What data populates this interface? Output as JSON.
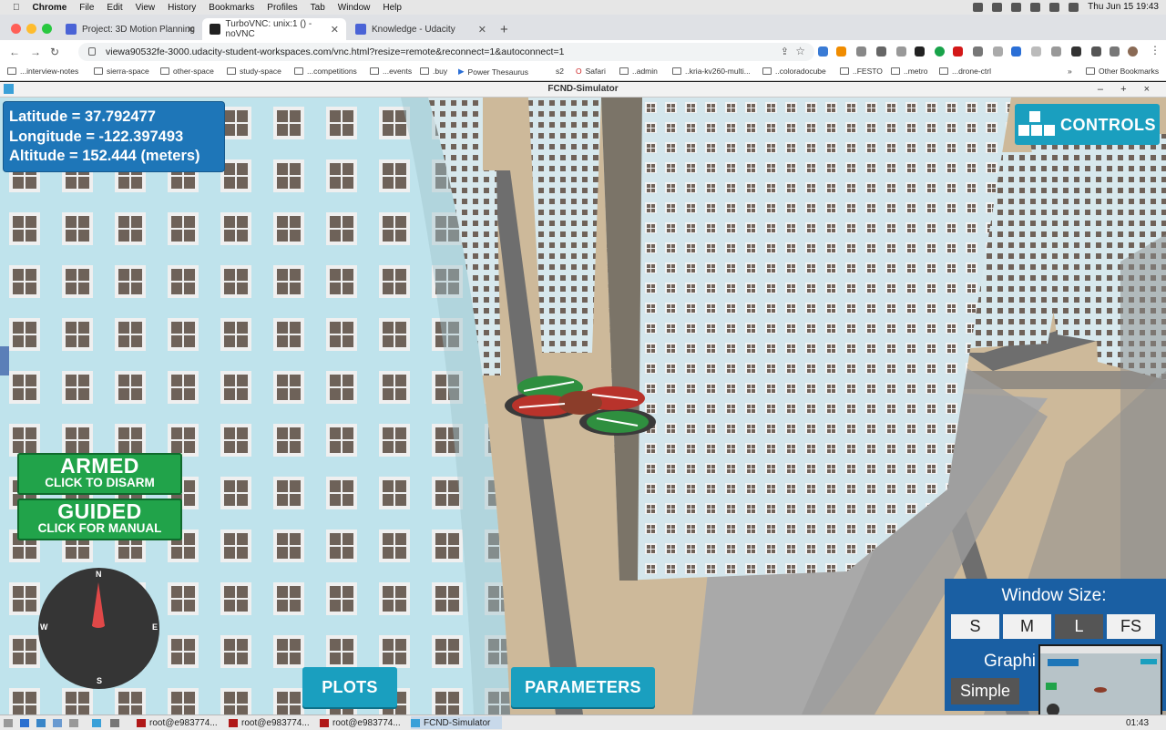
{
  "mac_menu": {
    "app": "Chrome",
    "items": [
      "File",
      "Edit",
      "View",
      "History",
      "Bookmarks",
      "Profiles",
      "Tab",
      "Window",
      "Help"
    ],
    "clock": "Thu Jun 15  19:43"
  },
  "tabs": [
    {
      "label": "Project: 3D Motion Planning",
      "favicon_color": "#4a63d6",
      "active": false
    },
    {
      "label": "TurboVNC: unix:1 () - noVNC",
      "favicon_color": "#222222",
      "active": true
    },
    {
      "label": "Knowledge - Udacity",
      "favicon_color": "#4a63d6",
      "active": false
    }
  ],
  "address": {
    "url": "viewa90532fe-3000.udacity-student-workspaces.com/vnc.html?resize=remote&reconnect=1&autoconnect=1"
  },
  "bookmarks": [
    "...interview-notes",
    "sierra-space",
    "other-space",
    "study-space",
    "...competitions",
    "...events",
    ".buy",
    "Power Thesaurus",
    "s2",
    "Safari",
    "..admin",
    "..kria-kv260-multi...",
    "..coloradocube",
    "..FESTO",
    "..metro",
    "...drone-ctrl"
  ],
  "bookmarks_more": "»",
  "bookmarks_other": "Other Bookmarks",
  "vnc_window": {
    "title": "FCND-Simulator",
    "controls": "– + ×"
  },
  "hud": {
    "latitude": "Latitude = 37.792477",
    "longitude": "Longitude = -122.397493",
    "altitude": "Altitude = 152.444 (meters)",
    "controls_label": "CONTROLS",
    "armed_title": "ARMED",
    "armed_sub": "CLICK TO DISARM",
    "guided_title": "GUIDED",
    "guided_sub": "CLICK FOR MANUAL",
    "compass": {
      "n": "N",
      "s": "S",
      "e": "E",
      "w": "W"
    },
    "plots_label": "PLOTS",
    "parameters_label": "PARAMETERS",
    "window_size_title": "Window Size:",
    "sizes": [
      "S",
      "M",
      "L",
      "FS"
    ],
    "selected_size": "L",
    "graphics_label": "Graphi",
    "simple_label": "Simple"
  },
  "taskbar": {
    "items": [
      "root@e983774...",
      "root@e983774...",
      "root@e983774..."
    ],
    "active": "FCND-Simulator",
    "clock": "01:43"
  },
  "colors": {
    "hud_blue": "#1e76b8",
    "armed_green": "#21a34a",
    "controls_cyan": "#1a9fbf"
  }
}
